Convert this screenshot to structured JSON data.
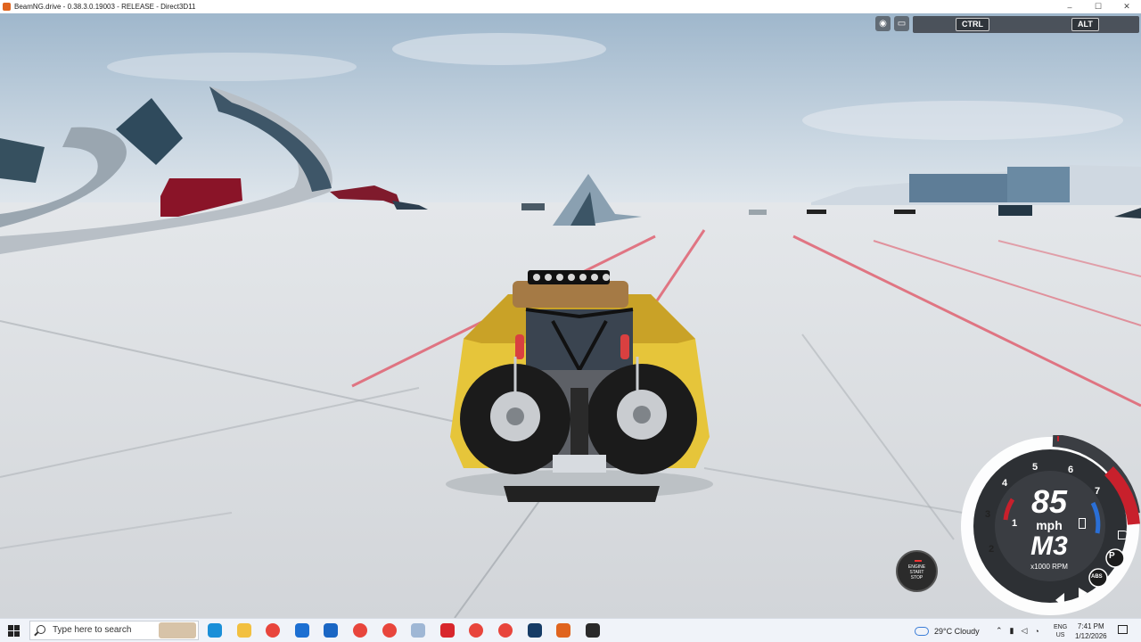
{
  "window": {
    "title": "BeamNG.drive - 0.38.3.0.19003 - RELEASE - Direct3D11",
    "controls": [
      "–",
      "☐",
      "✕"
    ]
  },
  "hud": {
    "keys": {
      "ctrl": "CTRL",
      "alt": "ALT"
    },
    "start_stop": {
      "line1": "ENGINE",
      "line2": "START",
      "line3": "STOP"
    },
    "dashboard": {
      "speed": "85",
      "speed_unit": "mph",
      "gear": "M3",
      "rpm_label": "x1000 RPM",
      "rpm_ticks": [
        "1",
        "2",
        "3",
        "4",
        "5",
        "6",
        "7"
      ],
      "parking_badge": "P",
      "abs_badge": "ABS",
      "redline_color": "#c8202c",
      "accent_color": "#2a6fd6"
    }
  },
  "taskbar": {
    "search_placeholder": "Type here to search",
    "apps": [
      {
        "name": "edge-icon",
        "color": "#1b8fd8"
      },
      {
        "name": "file-explorer-icon",
        "color": "#f2c040"
      },
      {
        "name": "chrome-icon",
        "color": "#e8453c"
      },
      {
        "name": "microsoft-store-icon",
        "color": "#1c6fd2"
      },
      {
        "name": "outlook-icon",
        "color": "#1a66c4"
      },
      {
        "name": "chrome-icon",
        "color": "#e8453c"
      },
      {
        "name": "chrome-icon",
        "color": "#e8453c"
      },
      {
        "name": "notepad-icon",
        "color": "#9fb7d5"
      },
      {
        "name": "wps-office-icon",
        "color": "#d8262c"
      },
      {
        "name": "chrome-icon",
        "color": "#e8453c"
      },
      {
        "name": "chrome-icon",
        "color": "#e8453c"
      },
      {
        "name": "steam-icon",
        "color": "#163c66"
      },
      {
        "name": "beamng-icon",
        "color": "#e0641e"
      },
      {
        "name": "app-icon",
        "color": "#2a2a2a"
      }
    ],
    "weather": "29°C  Cloudy",
    "language_top": "ENG",
    "language_bottom": "US",
    "time": "7:41 PM",
    "date": "1/12/2026"
  }
}
